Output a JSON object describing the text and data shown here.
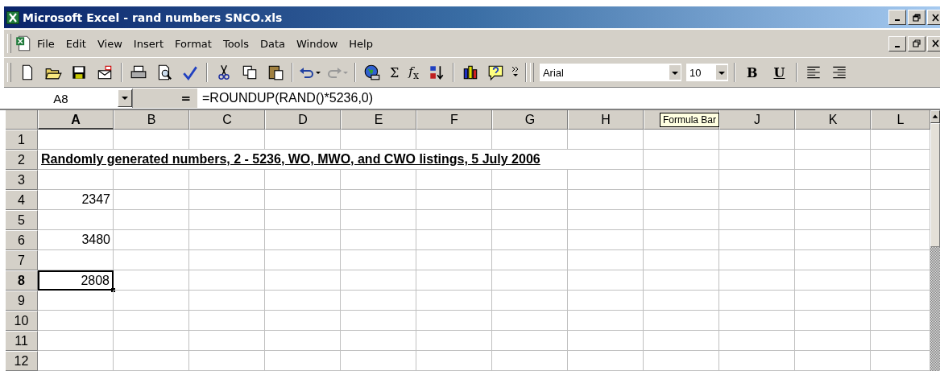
{
  "window": {
    "title": "Microsoft Excel - rand numbers SNCO.xls"
  },
  "menu": [
    "File",
    "Edit",
    "View",
    "Insert",
    "Format",
    "Tools",
    "Data",
    "Window",
    "Help"
  ],
  "toolbar": {
    "autosum": "Σ",
    "function": "*f*$_{x}$",
    "font": "Arial",
    "size": "10",
    "bold": "B",
    "underline": "U"
  },
  "formula_bar": {
    "name_box": "A8",
    "equals": "=",
    "formula": "=ROUNDUP(RAND()*5236,0)"
  },
  "tooltip": "Formula Bar",
  "columns": [
    {
      "label": "A",
      "selected": true
    },
    {
      "label": "B",
      "selected": false
    },
    {
      "label": "C",
      "selected": false
    },
    {
      "label": "D",
      "selected": false
    },
    {
      "label": "E",
      "selected": false
    },
    {
      "label": "F",
      "selected": false
    },
    {
      "label": "G",
      "selected": false
    },
    {
      "label": "H",
      "selected": false
    },
    {
      "selected": false
    },
    {
      "label": "J",
      "selected": false
    },
    {
      "label": "K",
      "selected": false
    },
    {
      "label": "L",
      "selected": false
    }
  ],
  "rows": [
    {
      "number": "1",
      "selected": false
    },
    {
      "number": "2",
      "selected": false,
      "title": "Randomly generated numbers, 2 - 5236, WO, MWO, and CWO listings, 5 July 2006"
    },
    {
      "number": "3",
      "selected": false
    },
    {
      "number": "4",
      "selected": false,
      "cell": {
        "kind": "number",
        "text": "2347",
        "active": false
      }
    },
    {
      "number": "5",
      "selected": false
    },
    {
      "number": "6",
      "selected": false,
      "cell": {
        "kind": "number",
        "text": "3480",
        "active": false
      }
    },
    {
      "number": "7",
      "selected": false
    },
    {
      "number": "8",
      "selected": true,
      "cell": {
        "kind": "number",
        "text": "2808",
        "active": true
      }
    },
    {
      "number": "9",
      "selected": false
    },
    {
      "number": "10",
      "selected": false
    },
    {
      "number": "11",
      "selected": false
    },
    {
      "number": "12",
      "selected": false
    }
  ]
}
